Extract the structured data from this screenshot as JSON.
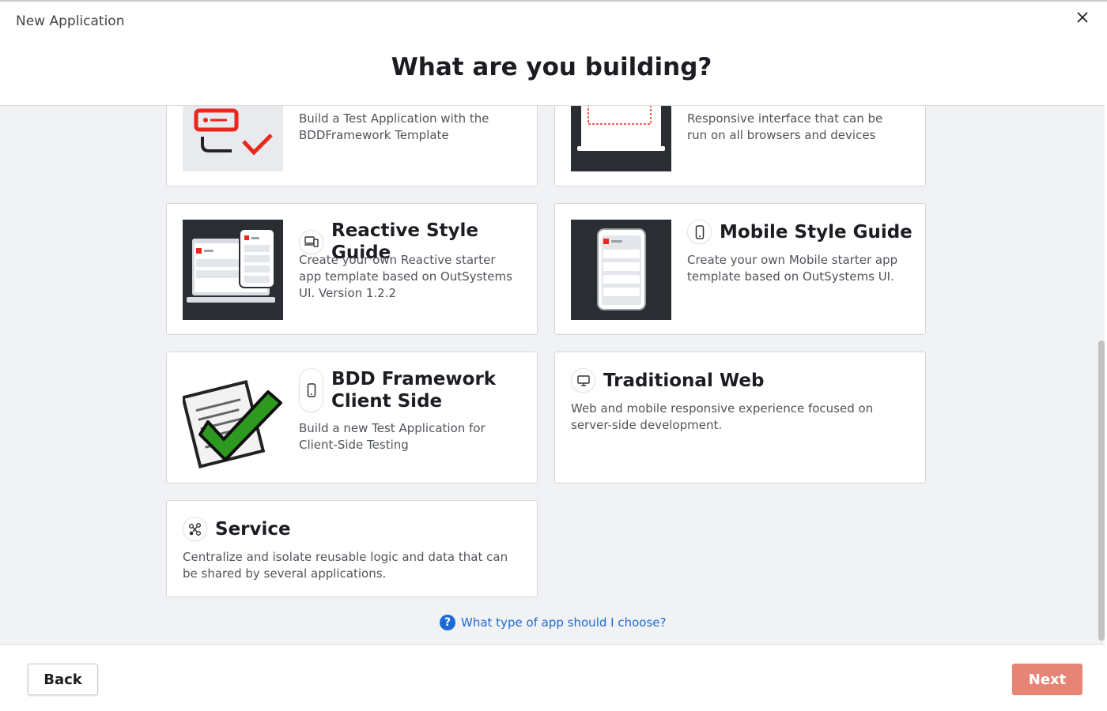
{
  "window": {
    "title": "New Application"
  },
  "heading": "What are you building?",
  "cards": [
    {
      "id": "bdd-template",
      "description": "Build a Test Application with the BDDFramework Template"
    },
    {
      "id": "reactive-web",
      "description": "Responsive interface that can be run on all browsers and devices"
    },
    {
      "id": "reactive-style-guide",
      "title": "Reactive Style Guide",
      "description": "Create your own Reactive starter app template based on OutSystems UI. Version 1.2.2",
      "icon": "devices-icon"
    },
    {
      "id": "mobile-style-guide",
      "title": "Mobile Style Guide",
      "description": "Create your own Mobile starter app template based on OutSystems UI.",
      "icon": "phone-icon"
    },
    {
      "id": "bdd-client-side",
      "title_line1": "BDD Framework",
      "title_line2": "Client Side",
      "description": "Build a new Test Application for Client-Side Testing",
      "icon": "phone-icon"
    },
    {
      "id": "traditional-web",
      "title": "Traditional Web",
      "description": "Web and mobile responsive experience focused on server-side development.",
      "icon": "monitor-icon"
    },
    {
      "id": "service",
      "title": "Service",
      "description": "Centralize and isolate reusable logic and data that can be shared by several applications.",
      "icon": "service-nodes-icon"
    }
  ],
  "help": {
    "icon_text": "?",
    "label": "What type of app should I choose?"
  },
  "footer": {
    "back_label": "Back",
    "next_label": "Next"
  },
  "colors": {
    "accent": "#e68476",
    "link": "#1d6ad4",
    "brand_red": "#e8281c"
  }
}
